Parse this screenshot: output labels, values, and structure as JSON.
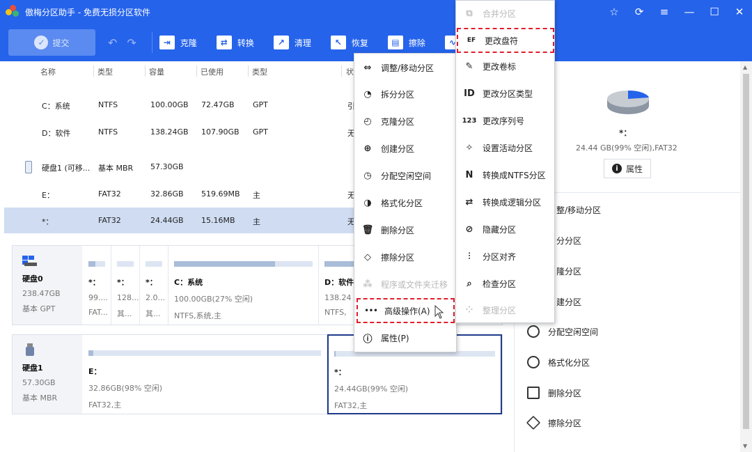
{
  "app": {
    "title": "傲梅分区助手 - 免费无损分区软件"
  },
  "window_controls": {
    "star": "☆",
    "refresh": "⟳",
    "menu": "≡",
    "minimize": "—",
    "maximize": "☐",
    "close": "✕"
  },
  "toolbar": {
    "commit": "提交",
    "items": [
      {
        "label": "克隆",
        "icon": "clone-icon"
      },
      {
        "label": "转换",
        "icon": "convert-icon"
      },
      {
        "label": "清理",
        "icon": "clean-icon"
      },
      {
        "label": "恢复",
        "icon": "recover-icon"
      },
      {
        "label": "擦除",
        "icon": "wipe-icon"
      }
    ]
  },
  "table": {
    "headers": [
      "名称",
      "类型",
      "容量",
      "已使用",
      "类型",
      "状"
    ],
    "rows": [
      {
        "name": "C：系统",
        "fs": "NTFS",
        "cap": "100.00GB",
        "used": "72.47GB",
        "type": "GPT",
        "status": "引"
      },
      {
        "name": "D：软件",
        "fs": "NTFS",
        "cap": "138.24GB",
        "used": "107.90GB",
        "type": "GPT",
        "status": "无"
      },
      {
        "name": "硬盘1 (可移...",
        "fs": "基本 MBR",
        "cap": "57.30GB",
        "used": "",
        "type": "",
        "status": ""
      },
      {
        "name": "E：",
        "fs": "FAT32",
        "cap": "32.86GB",
        "used": "519.69MB",
        "type": "主",
        "status": "无"
      },
      {
        "name": "*：",
        "fs": "FAT32",
        "cap": "24.44GB",
        "used": "15.16MB",
        "type": "主",
        "status": "无"
      }
    ]
  },
  "disk0": {
    "name": "硬盘0",
    "size": "238.47GB",
    "kind": "基本 GPT",
    "parts": [
      {
        "name": "*：",
        "info1": "99....",
        "info2": "FAT...",
        "fill": 0.4
      },
      {
        "name": "*：",
        "info1": "128...",
        "info2": "其...",
        "fill": 0.0
      },
      {
        "name": "*：",
        "info1": "2.0...",
        "info2": "其...",
        "fill": 0.0
      },
      {
        "name": "C：系统",
        "info1": "100.00GB(27% 空闲)",
        "info2": "NTFS,系统,主",
        "fill": 0.73
      },
      {
        "name": "D：软件",
        "info1": "138.24",
        "info2": "NTFS,",
        "fill": 0.78
      }
    ]
  },
  "disk1": {
    "name": "硬盘1",
    "size": "57.30GB",
    "kind": "基本 MBR",
    "parts": [
      {
        "name": "E：",
        "info1": "32.86GB(98% 空闲)",
        "info2": "FAT32,主",
        "fill": 0.02
      },
      {
        "name": "*：",
        "info1": "24.44GB(99% 空闲)",
        "info2": "FAT32,主",
        "fill": 0.01
      }
    ]
  },
  "side": {
    "name": "*：",
    "size": "24.44 GB(99% 空闲),FAT32",
    "prop_btn": "属性",
    "ops": [
      "整/移动分区",
      "分分区",
      "隆分区",
      "建分区",
      "分配空闲空间",
      "格式化分区",
      "删除分区",
      "擦除分区"
    ]
  },
  "menu1": [
    {
      "label": "调整/移动分区",
      "icon": "resize-icon",
      "glyph": "⇔",
      "disabled": false
    },
    {
      "label": "拆分分区",
      "icon": "split-icon",
      "glyph": "◔",
      "disabled": false
    },
    {
      "label": "克隆分区",
      "icon": "clone-partition-icon",
      "glyph": "◴",
      "disabled": false
    },
    {
      "label": "创建分区",
      "icon": "create-partition-icon",
      "glyph": "⊕",
      "disabled": false
    },
    {
      "label": "分配空闲空间",
      "icon": "allocate-icon",
      "glyph": "◷",
      "disabled": false
    },
    {
      "label": "格式化分区",
      "icon": "format-icon",
      "glyph": "◑",
      "disabled": false
    },
    {
      "label": "删除分区",
      "icon": "delete-icon",
      "glyph": "🗑",
      "disabled": false
    },
    {
      "label": "擦除分区",
      "icon": "wipe-partition-icon",
      "glyph": "◇",
      "disabled": false
    },
    {
      "label": "程序或文件夹迁移",
      "icon": "migrate-icon",
      "glyph": "⁂",
      "disabled": true
    },
    {
      "label": "高级操作(A)",
      "icon": "more-icon",
      "glyph": "•••",
      "disabled": false,
      "highlight": true
    },
    {
      "label": "属性(P)",
      "icon": "info-icon",
      "glyph": "ⓘ",
      "disabled": false
    }
  ],
  "menu2": [
    {
      "label": "合并分区",
      "icon": "merge-icon",
      "glyph": "⧉",
      "disabled": true
    },
    {
      "label": "更改盘符",
      "icon": "drive-letter-icon",
      "glyph": "EF",
      "disabled": false,
      "highlight": true
    },
    {
      "label": "更改卷标",
      "icon": "label-icon",
      "glyph": "✎",
      "disabled": false
    },
    {
      "label": "更改分区类型",
      "icon": "partition-type-icon",
      "glyph": "ID",
      "disabled": false
    },
    {
      "label": "更改序列号",
      "icon": "serial-icon",
      "glyph": "123",
      "disabled": false
    },
    {
      "label": "设置活动分区",
      "icon": "active-icon",
      "glyph": "✧",
      "disabled": false
    },
    {
      "label": "转换成NTFS分区",
      "icon": "ntfs-icon",
      "glyph": "N",
      "disabled": false
    },
    {
      "label": "转换成逻辑分区",
      "icon": "logical-icon",
      "glyph": "⇄",
      "disabled": false
    },
    {
      "label": "隐藏分区",
      "icon": "hide-icon",
      "glyph": "⊘",
      "disabled": false
    },
    {
      "label": "分区对齐",
      "icon": "align-icon",
      "glyph": "⫶",
      "disabled": false
    },
    {
      "label": "检查分区",
      "icon": "check-icon",
      "glyph": "⌕",
      "disabled": false
    },
    {
      "label": "整理分区",
      "icon": "defrag-icon",
      "glyph": "⁘",
      "disabled": true
    }
  ]
}
